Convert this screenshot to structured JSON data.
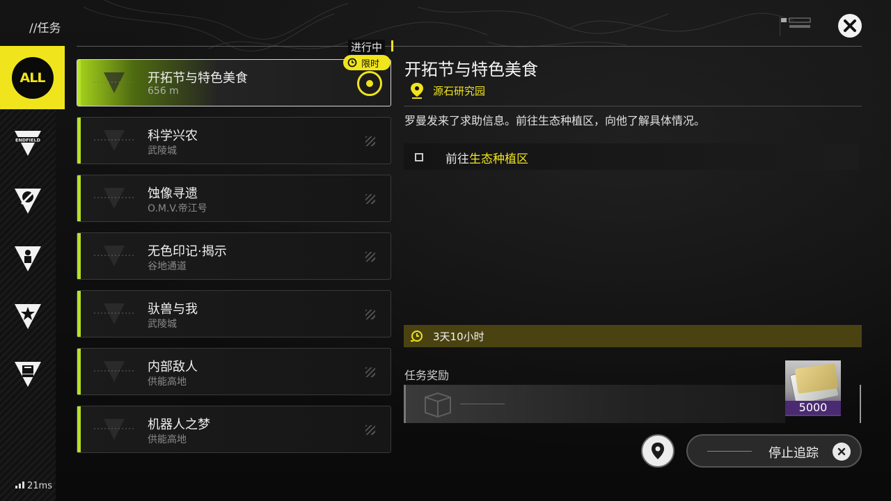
{
  "header": {
    "title": "//任务",
    "status_label": "进行中"
  },
  "sidebar": {
    "categories": [
      {
        "label": "ALL",
        "icon": "all-icon"
      },
      {
        "label": "ENDFIELD",
        "icon": "endfield-icon"
      },
      {
        "label": "",
        "icon": "wheel-icon"
      },
      {
        "label": "",
        "icon": "person-icon"
      },
      {
        "label": "",
        "icon": "star-icon"
      },
      {
        "label": "",
        "icon": "calendar-icon"
      }
    ]
  },
  "quests": [
    {
      "name": "开拓节与特色美食",
      "sub": "656 m",
      "active": true,
      "badge": "限时"
    },
    {
      "name": "科学兴农",
      "sub": "武陵城"
    },
    {
      "name": "蚀像寻遗",
      "sub": "O.M.V.帝江号"
    },
    {
      "name": "无色印记·揭示",
      "sub": "谷地通道"
    },
    {
      "name": "驮兽与我",
      "sub": "武陵城"
    },
    {
      "name": "内部敌人",
      "sub": "供能高地"
    },
    {
      "name": "机器人之梦",
      "sub": "供能高地"
    }
  ],
  "detail": {
    "title": "开拓节与特色美食",
    "location": "源石研究园",
    "description": "罗曼发来了求助信息。前往生态种植区，向他了解具体情况。",
    "objective_prefix": "前往",
    "objective_highlight": "生态种植区",
    "timer": "3天10小时",
    "reward_label": "任务奖励",
    "reward_qty": "5000"
  },
  "actions": {
    "stop_tracking": "停止追踪"
  },
  "network": {
    "ping": "21ms"
  },
  "colors": {
    "accent_yellow": "#f0e51c",
    "accent_green": "#b6e22a",
    "timer_bg": "#4a4311"
  }
}
